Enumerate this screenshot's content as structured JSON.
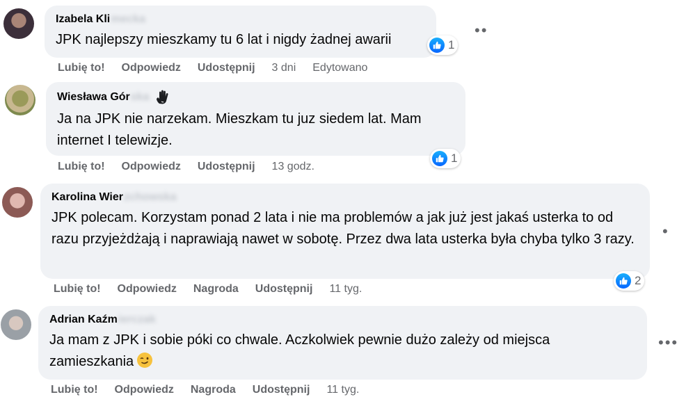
{
  "comments": [
    {
      "author": "Izabela Kli",
      "author_hidden": "mecka",
      "text": "JPK najlepszy mieszkamy tu 6 lat i nigdy żadnej awarii",
      "actions": [
        "Lubię to!",
        "Odpowiedz",
        "Udostępnij"
      ],
      "time": "3 dni",
      "edited": "Edytowano",
      "reactions": "1",
      "more": "••"
    },
    {
      "author": "Wiesława Gór",
      "author_hidden": "ska",
      "text": "Ja na JPK nie narzekam. Mieszkam tu juz siedem lat. Mam internet I telewizje.",
      "actions": [
        "Lubię to!",
        "Odpowiedz",
        "Udostępnij"
      ],
      "time": "13 godz.",
      "reactions": "1",
      "badge_icon": "waving-hand-icon"
    },
    {
      "author": "Karolina Wier",
      "author_hidden": "zchowska",
      "text": "JPK polecam. Korzystam ponad 2 lata i nie ma problemów a jak już jest jakaś usterka to od razu przyjeżdżają i naprawiają nawet w sobotę. Przez dwa lata usterka była chyba tylko 3 razy.",
      "actions": [
        "Lubię to!",
        "Odpowiedz",
        "Nagroda",
        "Udostępnij"
      ],
      "time": "11 tyg.",
      "reactions": "2",
      "more": "•"
    },
    {
      "author": "Adrian Kaźm",
      "author_hidden": "ierczak",
      "text": "Ja mam z JPK i sobie póki co chwale. Aczkolwiek pewnie dużo zależy od miejsca zamieszkania",
      "actions": [
        "Lubię to!",
        "Odpowiedz",
        "Nagroda",
        "Udostępnij"
      ],
      "time": "11 tyg.",
      "more": "•••",
      "emoji": "winking-face-emoji"
    }
  ],
  "colors": {
    "bubble": "#f0f2f5",
    "meta_text": "#65676b",
    "like_blue": "#0866ff"
  }
}
